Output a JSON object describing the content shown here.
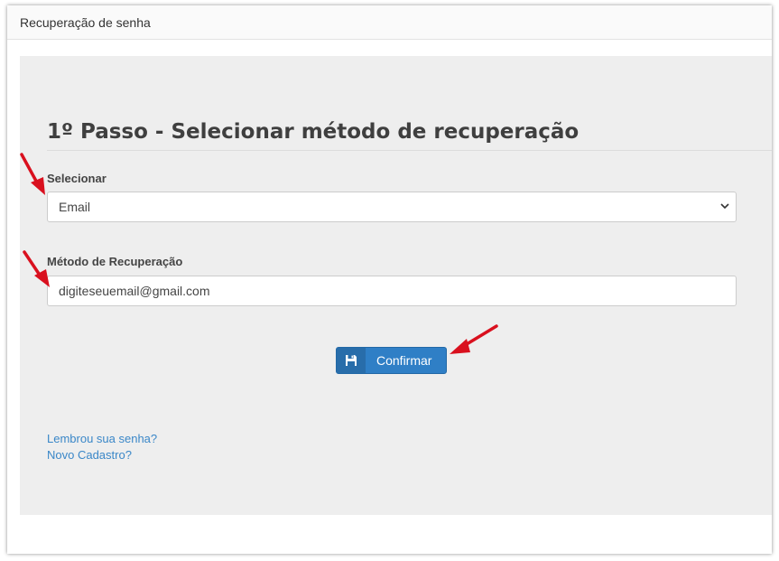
{
  "window": {
    "title": "Recuperação de senha"
  },
  "form": {
    "step_title": "1º Passo - Selecionar método de recuperação",
    "select_label": "Selecionar",
    "select_value": "Email",
    "method_label": "Método de Recuperação",
    "method_value": "digiteseuemail@gmail.com",
    "confirm_label": "Confirmar"
  },
  "links": {
    "remember": "Lembrou sua senha?",
    "register": "Novo Cadastro?"
  },
  "colors": {
    "primary_button": "#2f7fc6",
    "link": "#3a87c8",
    "annotation_arrow": "#d9101e",
    "panel_bg": "#eeeeee"
  },
  "icons": {
    "select_chevron": "chevron-down-icon",
    "confirm": "floppy-disk-icon",
    "annotation": "red-arrow-icon"
  }
}
